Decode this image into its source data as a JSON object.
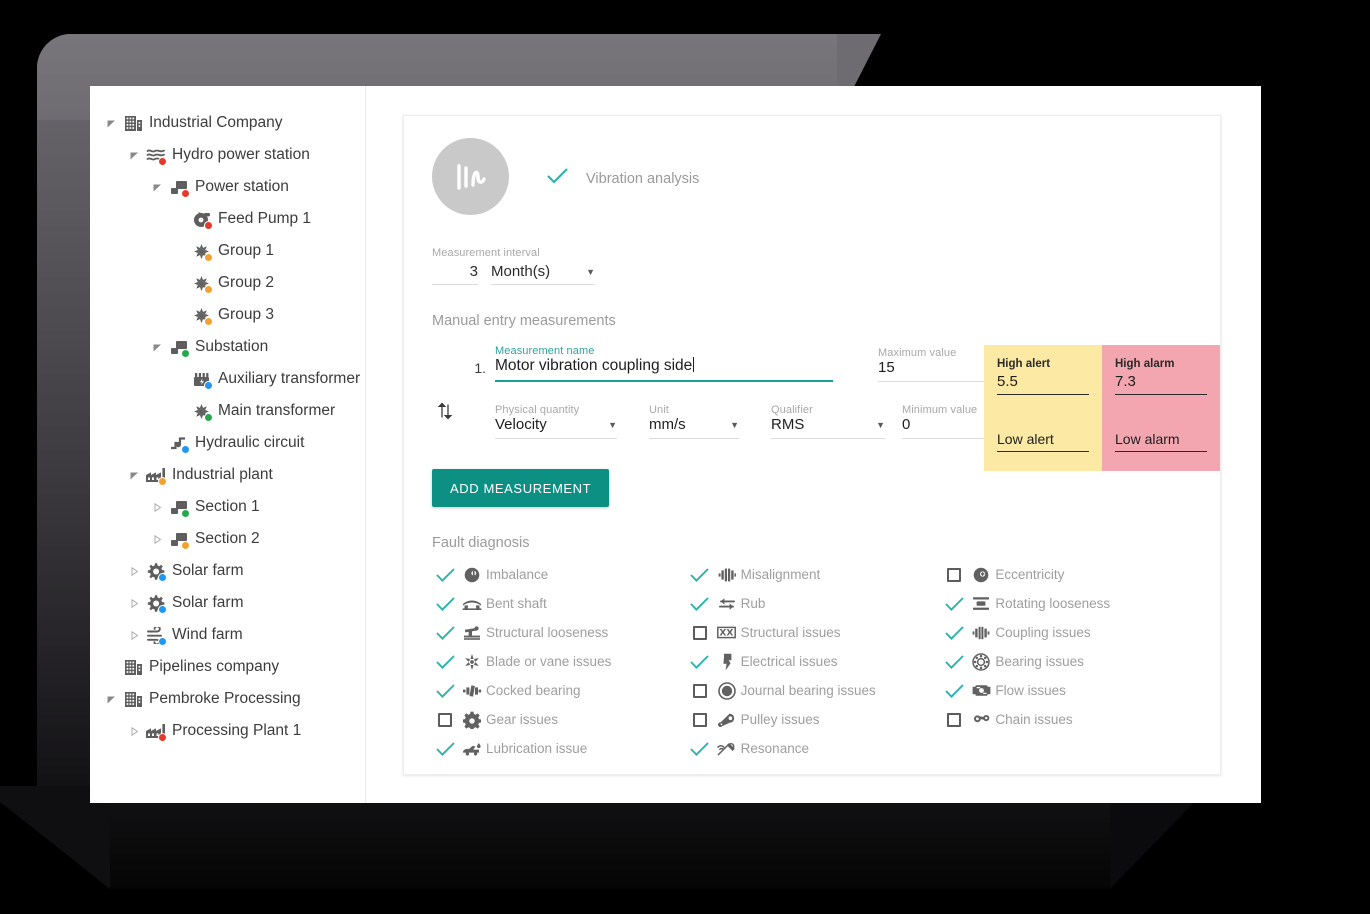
{
  "tree": {
    "items": [
      {
        "label": "Industrial Company",
        "indent": 0,
        "twisty": "open",
        "icon": "company-icon",
        "status": null
      },
      {
        "label": "Hydro power station",
        "indent": 1,
        "twisty": "open",
        "icon": "water-icon",
        "status": "#E8382C"
      },
      {
        "label": "Power station",
        "indent": 2,
        "twisty": "open",
        "icon": "station-icon",
        "status": "#E8382C"
      },
      {
        "label": "Feed Pump 1",
        "indent": 3,
        "twisty": "none",
        "icon": "pump-icon",
        "status": "#E8382C"
      },
      {
        "label": "Group 1",
        "indent": 3,
        "twisty": "none",
        "icon": "turbine-icon",
        "status": "#F2A130"
      },
      {
        "label": "Group 2",
        "indent": 3,
        "twisty": "none",
        "icon": "turbine-icon",
        "status": "#F2A130"
      },
      {
        "label": "Group 3",
        "indent": 3,
        "twisty": "none",
        "icon": "turbine-icon",
        "status": "#F2A130"
      },
      {
        "label": "Substation",
        "indent": 2,
        "twisty": "open",
        "icon": "station-icon",
        "status": "#26A74B"
      },
      {
        "label": "Auxiliary transformer",
        "indent": 3,
        "twisty": "none",
        "icon": "transformer-icon",
        "status": "#2196F3"
      },
      {
        "label": "Main transformer",
        "indent": 3,
        "twisty": "none",
        "icon": "turbine-icon",
        "status": "#26A74B"
      },
      {
        "label": "Hydraulic circuit",
        "indent": 2,
        "twisty": "none",
        "icon": "circuit-icon",
        "status": "#2196F3"
      },
      {
        "label": "Industrial plant",
        "indent": 1,
        "twisty": "open",
        "icon": "factory-icon",
        "status": "#F2A130"
      },
      {
        "label": "Section 1",
        "indent": 2,
        "twisty": "closed",
        "icon": "station-icon",
        "status": "#26A74B"
      },
      {
        "label": "Section 2",
        "indent": 2,
        "twisty": "closed",
        "icon": "station-icon",
        "status": "#F2A130"
      },
      {
        "label": "Solar farm",
        "indent": 1,
        "twisty": "closed",
        "icon": "solar-icon",
        "status": "#2196F3"
      },
      {
        "label": "Solar farm",
        "indent": 1,
        "twisty": "closed",
        "icon": "solar-icon",
        "status": "#2196F3"
      },
      {
        "label": "Wind farm",
        "indent": 1,
        "twisty": "closed",
        "icon": "wind-icon",
        "status": "#2196F3"
      },
      {
        "label": "Pipelines company",
        "indent": 0,
        "twisty": "none",
        "icon": "company-icon",
        "status": null
      },
      {
        "label": "Pembroke Processing",
        "indent": 0,
        "twisty": "open",
        "icon": "company-icon",
        "status": null
      },
      {
        "label": "Processing Plant 1",
        "indent": 1,
        "twisty": "closed",
        "icon": "factory-icon",
        "status": "#E8382C"
      }
    ]
  },
  "header": {
    "avatar_icon": "vibration-waveform-icon",
    "check_icon": "check-icon",
    "title": "Vibration analysis"
  },
  "interval": {
    "label": "Measurement interval",
    "value": "3",
    "unit": "Month(s)",
    "caret_icon": "chevron-down-icon"
  },
  "manual": {
    "section_title": "Manual entry measurements",
    "reorder_icon": "reorder-arrows-icon",
    "index": "1.",
    "name_label": "Measurement name",
    "name_value": "Motor vibration coupling side",
    "max_label": "Maximum value",
    "max_value": "15",
    "min_label": "Minimum value",
    "min_value": "0",
    "physical_quantity_label": "Physical quantity",
    "physical_quantity_value": "Velocity",
    "unit_label": "Unit",
    "unit_value": "mm/s",
    "qualifier_label": "Qualifier",
    "qualifier_value": "RMS",
    "alerts": {
      "high_alert_label": "High alert",
      "high_alert_value": "5.5",
      "low_alert_label": "Low alert",
      "low_alert_value": "",
      "high_alarm_label": "High alarm",
      "high_alarm_value": "7.3",
      "low_alarm_label": "Low alarm",
      "low_alarm_value": "",
      "alert_color": "#FBE9A4",
      "alarm_color": "#F3A6B0"
    },
    "add_button": "ADD MEASUREMENT",
    "accent_color": "#0c9083"
  },
  "fault_diagnosis": {
    "title": "Fault diagnosis",
    "columns": [
      [
        {
          "label": "Imbalance",
          "checked": true,
          "icon": "imbalance-icon"
        },
        {
          "label": "Bent shaft",
          "checked": true,
          "icon": "bent-shaft-icon"
        },
        {
          "label": "Structural looseness",
          "checked": true,
          "icon": "structural-looseness-icon"
        },
        {
          "label": "Blade or vane issues",
          "checked": true,
          "icon": "blade-icon"
        },
        {
          "label": "Cocked bearing",
          "checked": true,
          "icon": "cocked-bearing-icon"
        },
        {
          "label": "Gear issues",
          "checked": false,
          "icon": "gear-icon"
        },
        {
          "label": "Lubrication issue",
          "checked": true,
          "icon": "lubrication-icon"
        }
      ],
      [
        {
          "label": "Misalignment",
          "checked": true,
          "icon": "misalignment-icon"
        },
        {
          "label": "Rub",
          "checked": true,
          "icon": "rub-icon"
        },
        {
          "label": "Structural issues",
          "checked": false,
          "icon": "structural-issues-icon"
        },
        {
          "label": "Electrical issues",
          "checked": true,
          "icon": "electrical-icon"
        },
        {
          "label": "Journal bearing issues",
          "checked": false,
          "icon": "journal-bearing-icon"
        },
        {
          "label": "Pulley issues",
          "checked": false,
          "icon": "pulley-icon"
        },
        {
          "label": "Resonance",
          "checked": true,
          "icon": "resonance-icon"
        }
      ],
      [
        {
          "label": "Eccentricity",
          "checked": false,
          "icon": "eccentricity-icon"
        },
        {
          "label": "Rotating looseness",
          "checked": true,
          "icon": "rotating-looseness-icon"
        },
        {
          "label": "Coupling issues",
          "checked": true,
          "icon": "coupling-icon"
        },
        {
          "label": "Bearing issues",
          "checked": true,
          "icon": "bearing-icon"
        },
        {
          "label": "Flow issues",
          "checked": true,
          "icon": "flow-icon"
        },
        {
          "label": "Chain issues",
          "checked": false,
          "icon": "chain-icon"
        }
      ]
    ]
  }
}
